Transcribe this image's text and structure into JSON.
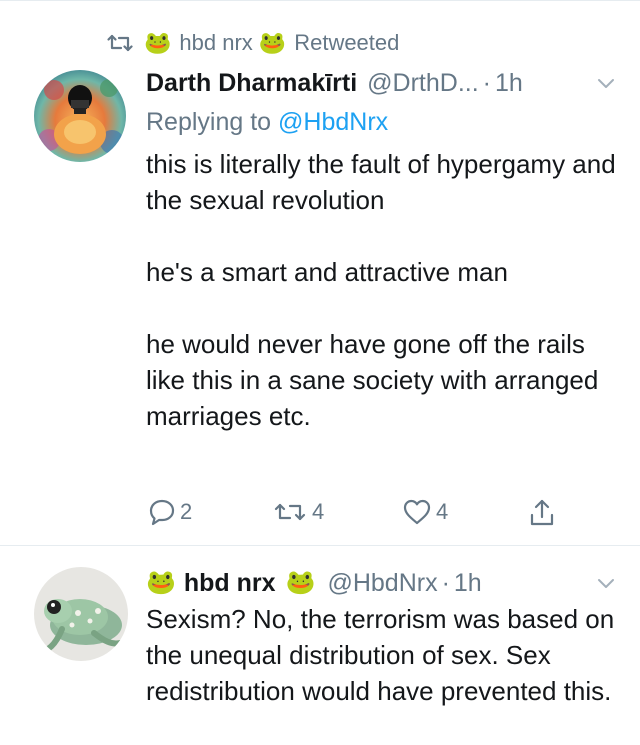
{
  "retweet_bar": {
    "icon": "retweet-icon",
    "emoji_left": "🐸",
    "name": "hbd nrx",
    "emoji_right": "🐸",
    "label": "Retweeted"
  },
  "tweet1": {
    "display_name": "Darth Dharmakīrti",
    "handle": "@DrthD...",
    "separator": "·",
    "time": "1h",
    "reply_prefix": "Replying to",
    "reply_mention": "@HbdNrx",
    "paragraphs": [
      "this is literally the fault of hypergamy and the sexual revolution",
      "he's a smart and attractive man",
      "he would never have gone off the rails like this in a sane society with arranged marriages etc."
    ],
    "actions": {
      "reply_count": "2",
      "retweet_count": "4",
      "like_count": "4"
    }
  },
  "tweet2": {
    "emoji_left": "🐸",
    "display_name": "hbd nrx",
    "emoji_right": "🐸",
    "handle": "@HbdNrx",
    "separator": "·",
    "time": "1h",
    "text": "Sexism? No, the terrorism was based on the unequal distribution of sex. Sex redistribution would have prevented this."
  },
  "colors": {
    "text": "#14171a",
    "muted": "#657786",
    "link": "#1da1f2",
    "divider": "#e6ecf0"
  }
}
